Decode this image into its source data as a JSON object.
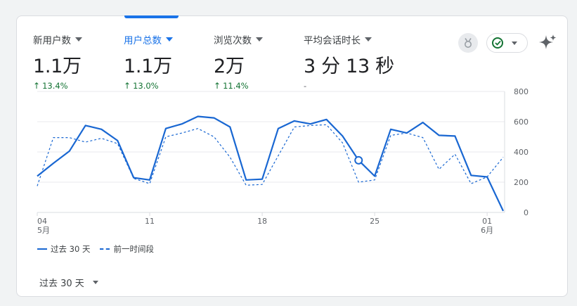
{
  "metrics": [
    {
      "label": "新用户数",
      "value": "1.1万",
      "change": "13.4%",
      "active": false
    },
    {
      "label": "用户总数",
      "value": "1.1万",
      "change": "13.0%",
      "active": true
    },
    {
      "label": "浏览次数",
      "value": "2万",
      "change": "11.4%",
      "active": false
    },
    {
      "label": "平均会话时长",
      "value": "3 分 13 秒",
      "change": "-",
      "active": false
    }
  ],
  "colors": {
    "accent": "#1a73e8",
    "series": "#1967d2",
    "positive": "#137333"
  },
  "legend": {
    "current": "过去 30 天",
    "previous": "前一时间段"
  },
  "period_selector": {
    "label": "过去 30 天"
  },
  "chart_data": {
    "type": "line",
    "y_ticks": [
      "800",
      "600",
      "400",
      "200",
      "0"
    ],
    "ylim": [
      0,
      800
    ],
    "x_tick_labels": [
      {
        "day": "04",
        "month": "5月",
        "index": 0
      },
      {
        "day": "11",
        "month": "",
        "index": 7
      },
      {
        "day": "18",
        "month": "",
        "index": 14
      },
      {
        "day": "25",
        "month": "",
        "index": 21
      },
      {
        "day": "01",
        "month": "6月",
        "index": 28
      }
    ],
    "series": [
      {
        "name": "过去 30 天",
        "style": "solid",
        "values": [
          240,
          325,
          405,
          575,
          550,
          475,
          230,
          215,
          555,
          585,
          635,
          625,
          565,
          215,
          220,
          555,
          605,
          585,
          615,
          505,
          345,
          240,
          550,
          525,
          595,
          510,
          505,
          245,
          235,
          10
        ]
      },
      {
        "name": "前一时间段",
        "style": "dashed",
        "values": [
          175,
          495,
          495,
          465,
          490,
          455,
          225,
          190,
          500,
          525,
          555,
          500,
          365,
          180,
          185,
          375,
          565,
          575,
          580,
          460,
          200,
          215,
          510,
          525,
          495,
          285,
          385,
          190,
          235,
          365
        ]
      }
    ],
    "highlight_index": 20,
    "grid": true
  }
}
